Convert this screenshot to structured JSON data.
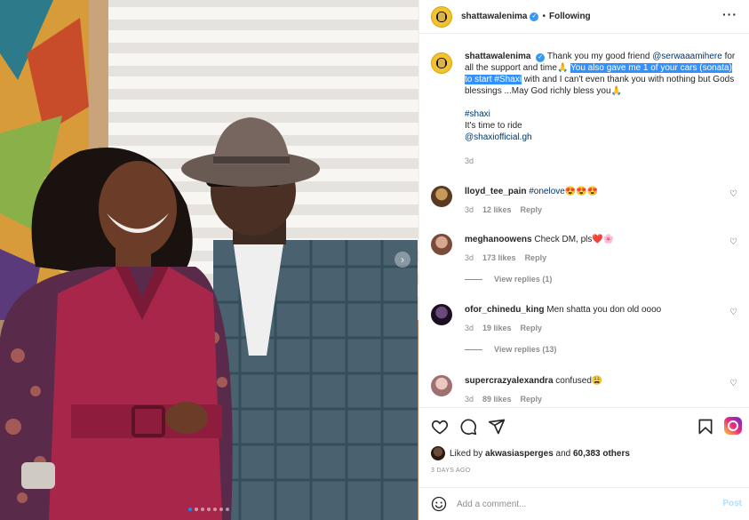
{
  "post": {
    "username": "shattawalenima",
    "follow_status": "Following",
    "separator": "•",
    "more_icon": "more-horizontal-icon"
  },
  "caption": {
    "username": "shattawalenima",
    "text_1": "Thank you my good friend ",
    "mention_1": "@serwaaamihere",
    "text_2": " for all the support and time🙏 ",
    "highlight": "You also gave me 1 of your cars (sonata) to start #Shaxi",
    "text_3": " with and I can't even thank you with nothing but Gods blessings ...May God richly bless you🙏",
    "hashtag": "#shaxi",
    "line_2": "It's time to ride",
    "mention_2": "@shaxiofficial.gh",
    "time": "3d"
  },
  "comments": [
    {
      "username": "lloyd_tee_pain",
      "text": "#onelove",
      "emoji": "😍😍😍",
      "time": "3d",
      "likes": "12 likes",
      "reply": "Reply",
      "avatar_color": "#b07a3c"
    },
    {
      "username": "meghanoowens",
      "text": "Check DM, pls",
      "emoji": "❤️🌸",
      "time": "3d",
      "likes": "173 likes",
      "reply": "Reply",
      "view_replies": "View replies (1)",
      "avatar_color": "#c98f7e"
    },
    {
      "username": "ofor_chinedu_king",
      "text": "Men shatta you don old oooo",
      "time": "3d",
      "likes": "19 likes",
      "reply": "Reply",
      "view_replies": "View replies (13)",
      "avatar_color": "#3a2a4a"
    },
    {
      "username": "supercrazyalexandra",
      "text": "confused",
      "emoji": "😩",
      "time": "3d",
      "likes": "89 likes",
      "reply": "Reply",
      "avatar_color": "#d8b0a8"
    }
  ],
  "actions": {
    "like_icon": "heart-icon",
    "comment_icon": "comment-icon",
    "share_icon": "paper-plane-icon",
    "save_icon": "bookmark-icon",
    "liked_by_prefix": "Liked by ",
    "liked_by_user": "akwasiasperges",
    "liked_by_suffix": " and ",
    "liked_by_count": "60,383 others",
    "posted_ago": "3 DAYS AGO"
  },
  "add_comment": {
    "placeholder": "Add a comment...",
    "post_label": "Post"
  },
  "carousel": {
    "total": 7,
    "current": 1
  },
  "colors": {
    "accent_blue": "#0095f6",
    "link": "#00376b",
    "selection": "#3390ff",
    "muted": "#8e8e8e"
  }
}
